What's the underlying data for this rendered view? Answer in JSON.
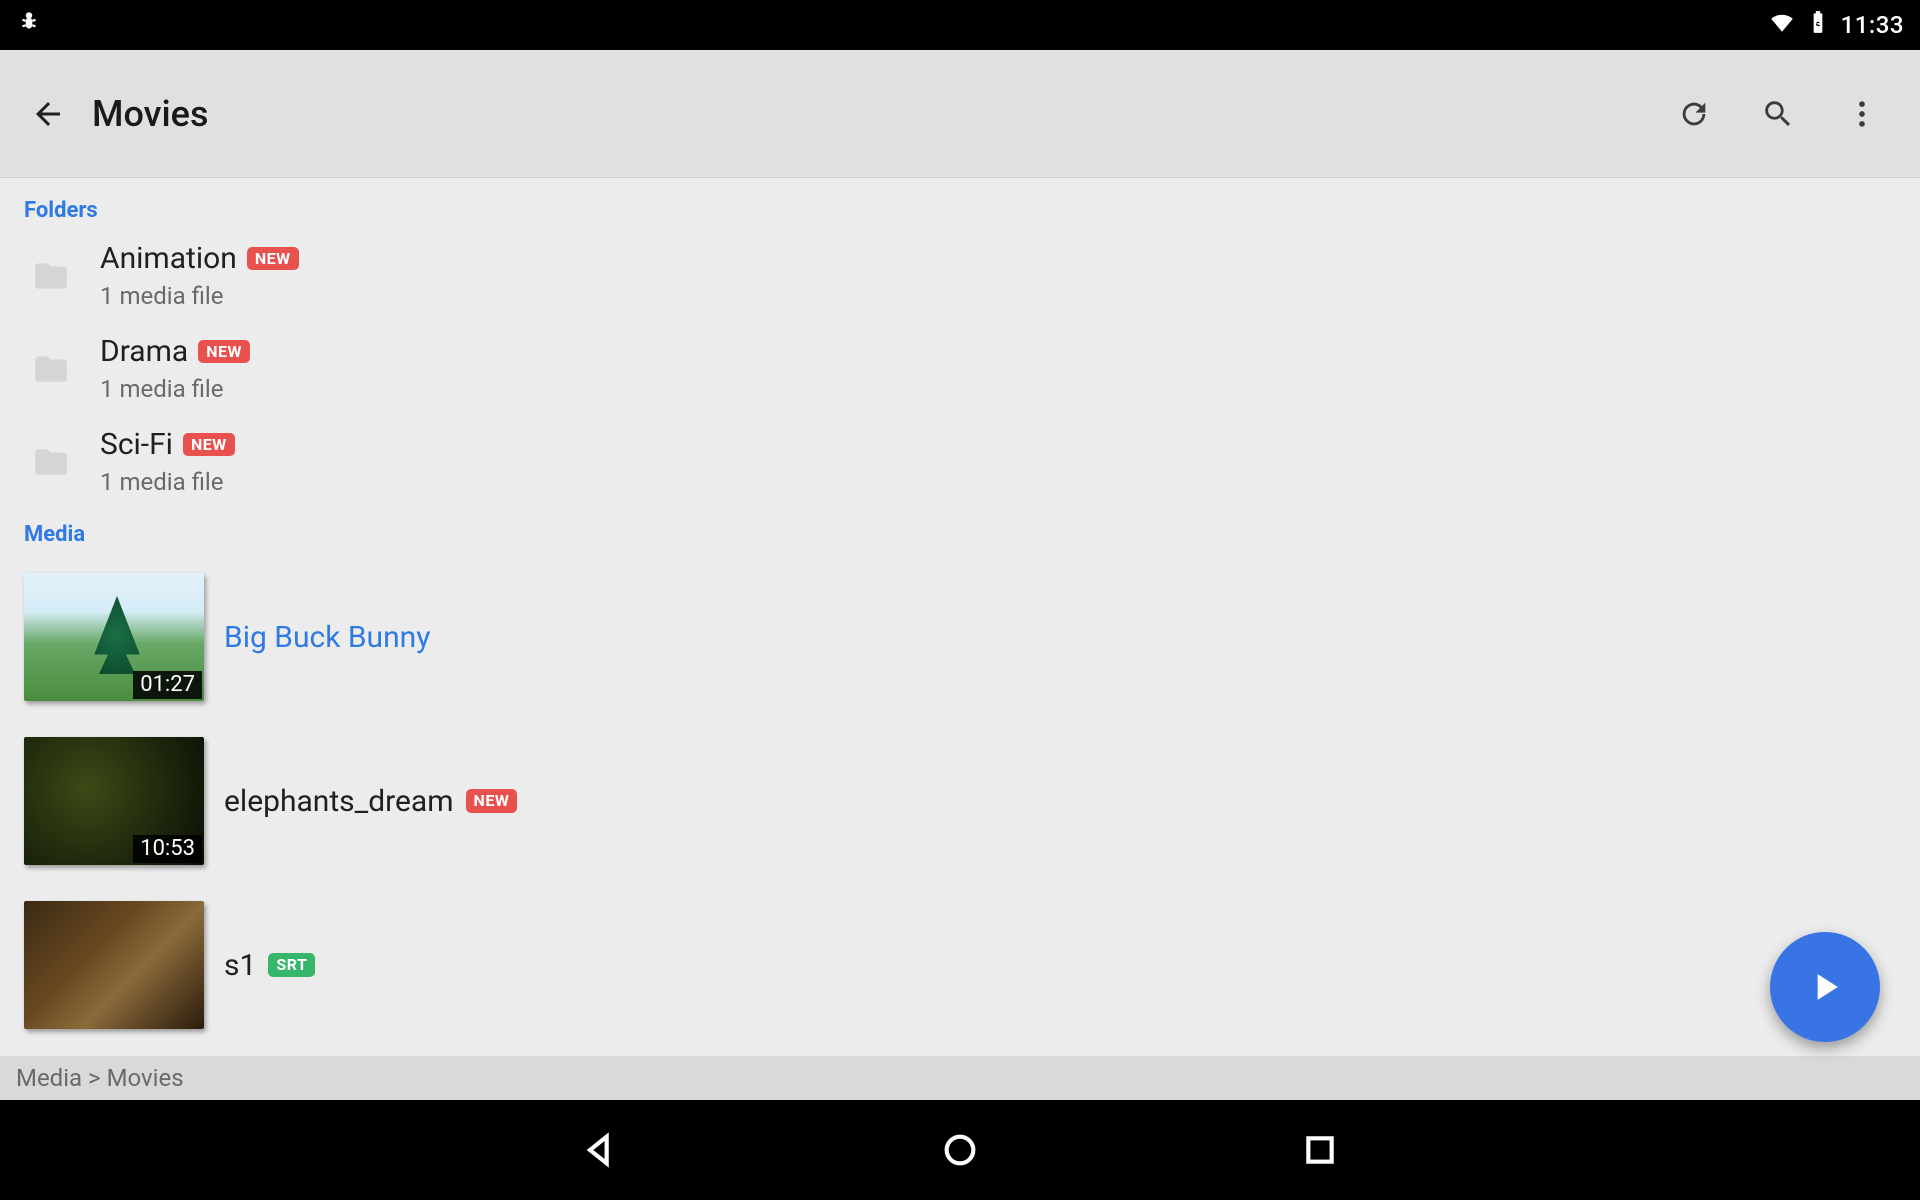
{
  "status": {
    "clock": "11:33"
  },
  "toolbar": {
    "title": "Movies"
  },
  "sections": {
    "folders_label": "Folders",
    "media_label": "Media"
  },
  "folders": [
    {
      "name": "Animation",
      "sub": "1 media file",
      "badge": "NEW"
    },
    {
      "name": "Drama",
      "sub": "1 media file",
      "badge": "NEW"
    },
    {
      "name": "Sci-Fi",
      "sub": "1 media file",
      "badge": "NEW"
    }
  ],
  "media": [
    {
      "title": "Big Buck Bunny",
      "duration": "01:27",
      "playing": true,
      "badge": null,
      "thumb": "bbb"
    },
    {
      "title": "elephants_dream",
      "duration": "10:53",
      "playing": false,
      "badge": "NEW",
      "thumb": "elephants"
    },
    {
      "title": "s1",
      "duration": "",
      "playing": false,
      "badge": "SRT",
      "thumb": "s1"
    }
  ],
  "breadcrumb": "Media > Movies"
}
